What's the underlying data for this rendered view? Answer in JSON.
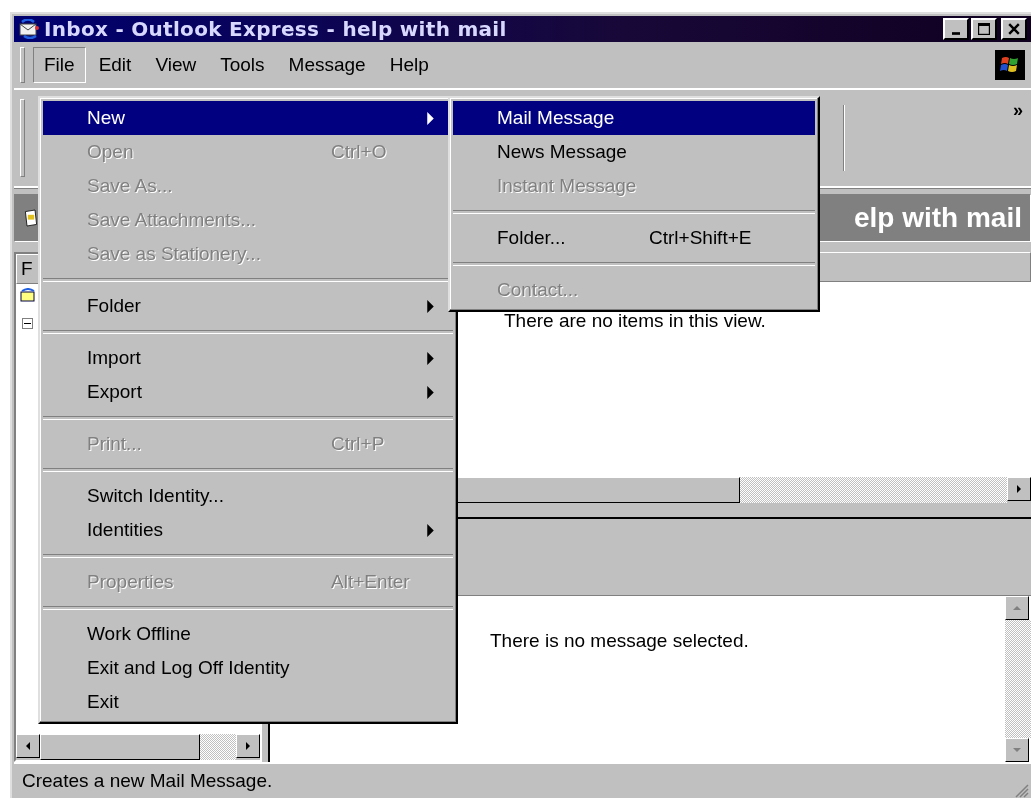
{
  "window": {
    "title": "Inbox - Outlook Express - help with mail"
  },
  "menu_bar": [
    {
      "label": "File",
      "selected": true
    },
    {
      "label": "Edit",
      "selected": false
    },
    {
      "label": "View",
      "selected": false
    },
    {
      "label": "Tools",
      "selected": false
    },
    {
      "label": "Message",
      "selected": false
    },
    {
      "label": "Help",
      "selected": false
    }
  ],
  "toolbar": {
    "chevron": "»"
  },
  "folder_bar": {
    "title": "elp with mail"
  },
  "folder_pane": {
    "column_header": "F"
  },
  "message_list": {
    "empty_text": "There are no items in this view."
  },
  "preview_pane": {
    "empty_text": "There is no message selected."
  },
  "file_menu": [
    {
      "kind": "item",
      "label": "New",
      "submenu": true,
      "disabled": false,
      "selected": true
    },
    {
      "kind": "item",
      "label": "Open",
      "shortcut": "Ctrl+O",
      "submenu": false,
      "disabled": true,
      "selected": false
    },
    {
      "kind": "item",
      "label": "Save As...",
      "submenu": false,
      "disabled": true,
      "selected": false
    },
    {
      "kind": "item",
      "label": "Save Attachments...",
      "submenu": false,
      "disabled": true,
      "selected": false
    },
    {
      "kind": "item",
      "label": "Save as Stationery...",
      "submenu": false,
      "disabled": true,
      "selected": false
    },
    {
      "kind": "separator"
    },
    {
      "kind": "item",
      "label": "Folder",
      "submenu": true,
      "disabled": false,
      "selected": false
    },
    {
      "kind": "separator"
    },
    {
      "kind": "item",
      "label": "Import",
      "submenu": true,
      "disabled": false,
      "selected": false
    },
    {
      "kind": "item",
      "label": "Export",
      "submenu": true,
      "disabled": false,
      "selected": false
    },
    {
      "kind": "separator"
    },
    {
      "kind": "item",
      "label": "Print...",
      "shortcut": "Ctrl+P",
      "submenu": false,
      "disabled": true,
      "selected": false
    },
    {
      "kind": "separator"
    },
    {
      "kind": "item",
      "label": "Switch Identity...",
      "submenu": false,
      "disabled": false,
      "selected": false
    },
    {
      "kind": "item",
      "label": "Identities",
      "submenu": true,
      "disabled": false,
      "selected": false
    },
    {
      "kind": "separator"
    },
    {
      "kind": "item",
      "label": "Properties",
      "shortcut": "Alt+Enter",
      "submenu": false,
      "disabled": true,
      "selected": false
    },
    {
      "kind": "separator"
    },
    {
      "kind": "item",
      "label": "Work Offline",
      "submenu": false,
      "disabled": false,
      "selected": false
    },
    {
      "kind": "item",
      "label": "Exit and Log Off Identity",
      "submenu": false,
      "disabled": false,
      "selected": false
    },
    {
      "kind": "item",
      "label": "Exit",
      "submenu": false,
      "disabled": false,
      "selected": false
    }
  ],
  "new_submenu": [
    {
      "kind": "item",
      "label": "Mail Message",
      "submenu": false,
      "disabled": false,
      "selected": true
    },
    {
      "kind": "item",
      "label": "News Message",
      "submenu": false,
      "disabled": false,
      "selected": false
    },
    {
      "kind": "item",
      "label": "Instant Message",
      "submenu": false,
      "disabled": true,
      "selected": false
    },
    {
      "kind": "separator"
    },
    {
      "kind": "item",
      "label": "Folder...",
      "shortcut": "Ctrl+Shift+E",
      "submenu": false,
      "disabled": false,
      "selected": false
    },
    {
      "kind": "separator"
    },
    {
      "kind": "item",
      "label": "Contact...",
      "submenu": false,
      "disabled": true,
      "selected": false
    }
  ],
  "status_bar": {
    "text": "Creates a new Mail Message."
  }
}
